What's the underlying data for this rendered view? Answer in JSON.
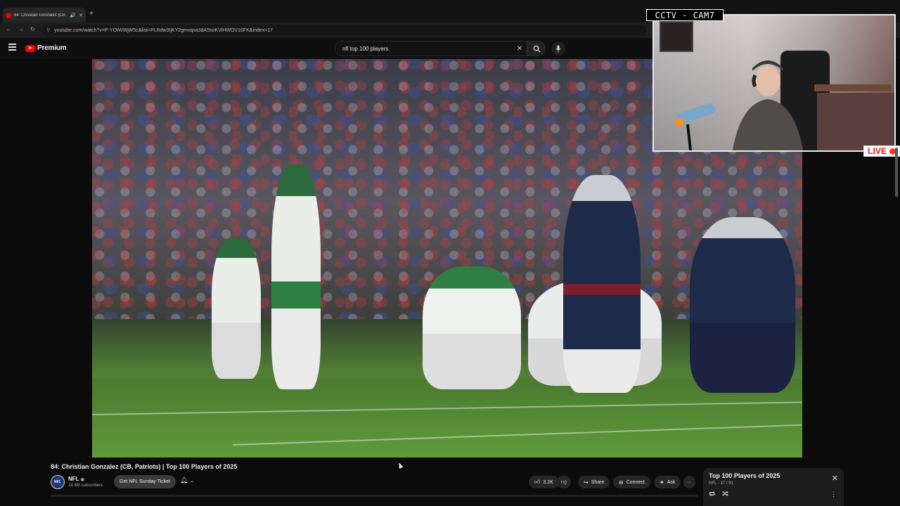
{
  "browser": {
    "tab_title": "84: Christian Gonzalez (CB...",
    "url": "youtube.com/watch?v=P-YOtWWjW5c&list=PLRdw3IjKY2gmvqxa3dA5soKViHWOV16FK&index=17"
  },
  "youtube": {
    "logo_label": "Premium",
    "search_value": "nfl top 100 players"
  },
  "video": {
    "title": "84: Christian Gonzalez (CB, Patriots) | Top 100 Players of 2025",
    "channel_name": "NFL",
    "channel_subs": "18.3M subscribers",
    "avatar_text": "NFL",
    "ticket_button": "Get NFL Sunday Ticket",
    "likes": "3.2K",
    "share_label": "Share",
    "connect_label": "Connect",
    "ask_label": "Ask",
    "more_label": "···"
  },
  "playlist": {
    "title": "Top 100 Players of 2025",
    "subtitle": "NFL - 17 / 91"
  },
  "overlay": {
    "cam_label": "CCTV - CAM7",
    "live_label": "LIVE"
  },
  "colors": {
    "accent_red": "#ff0000",
    "background": "#0f0f0f",
    "live_red": "#ff3030"
  }
}
